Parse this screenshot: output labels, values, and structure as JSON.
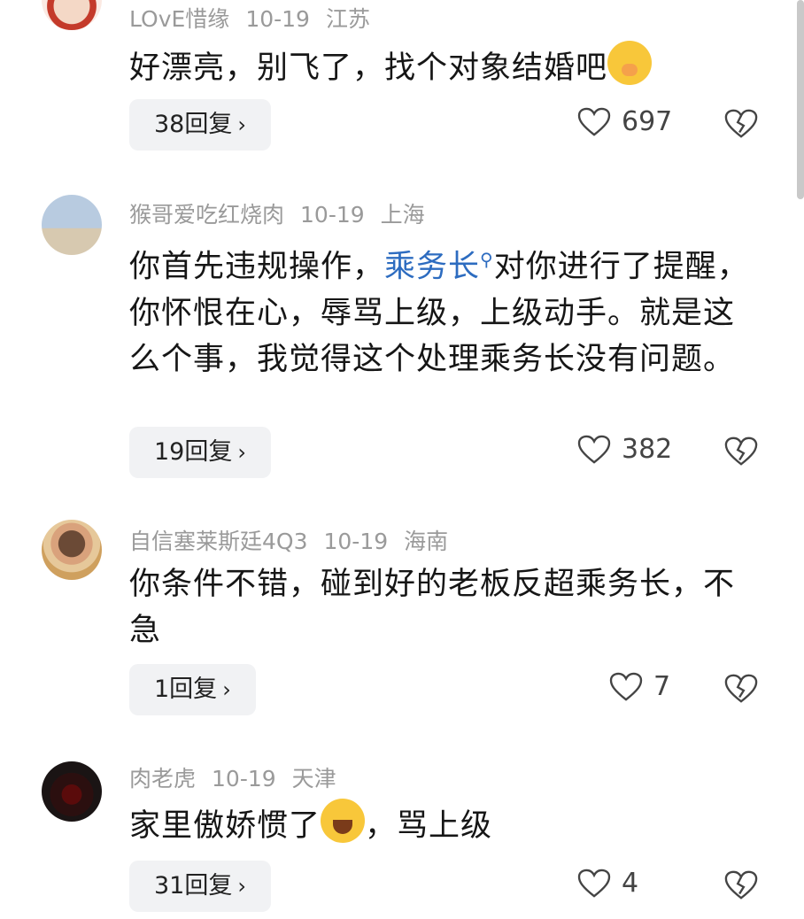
{
  "comments": [
    {
      "user": "LOvE惜缘",
      "date": "10-19",
      "location": "江苏",
      "text": "好漂亮，别飞了，找个对象结婚吧",
      "replies": "38回复",
      "likes": "697"
    },
    {
      "user": "猴哥爱吃红烧肉",
      "date": "10-19",
      "location": "上海",
      "text_before": "你首先违规操作，",
      "link": "乘务长",
      "text_after": "对你进行了提醒，你怀恨在心，辱骂上级，上级动手。就是这么个事，我觉得这个处理乘务长没有问题。",
      "replies": "19回复",
      "likes": "382"
    },
    {
      "user": "自信塞莱斯廷4Q3",
      "date": "10-19",
      "location": "海南",
      "text": "你条件不错，碰到好的老板反超乘务长，不急",
      "replies": "1回复",
      "likes": "7"
    },
    {
      "user": "肉老虎",
      "date": "10-19",
      "location": "天津",
      "text_before": "家里傲娇惯了",
      "text_after": "，骂上级",
      "replies": "31回复",
      "likes": "4"
    }
  ],
  "icons": {
    "like": "heart-icon",
    "dislike": "broken-heart-icon",
    "chevron": "chevron-right-icon",
    "search": "search-icon"
  }
}
